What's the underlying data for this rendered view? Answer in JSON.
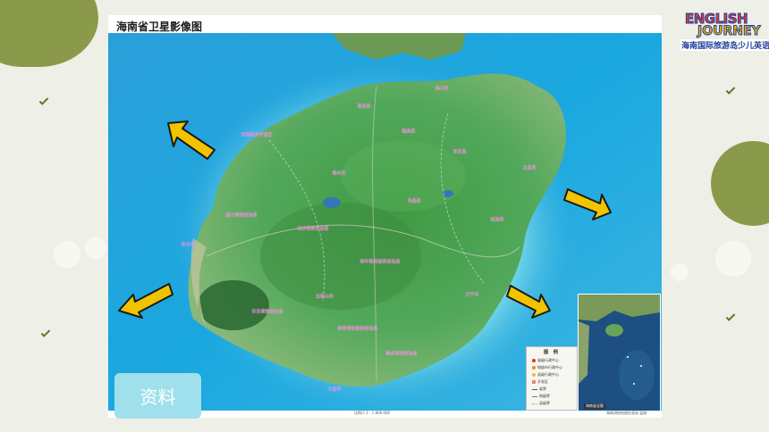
{
  "map": {
    "title": "海南省卫星影像图",
    "scale_text": "比例尺 1 : 1 800 000",
    "credit_text": "海南测绘地理信息局 监制",
    "inset_caption": "海南省全图",
    "places": [
      {
        "name": "洋浦经济开发区"
      },
      {
        "name": "海口市"
      },
      {
        "name": "文昌市"
      },
      {
        "name": "琼海市"
      },
      {
        "name": "万宁市"
      },
      {
        "name": "澄迈县"
      },
      {
        "name": "定安县"
      },
      {
        "name": "儋州市"
      },
      {
        "name": "屯昌县"
      },
      {
        "name": "昌江黎族自治县"
      },
      {
        "name": "琼中黎族苗族自治县"
      },
      {
        "name": "东方市"
      },
      {
        "name": "五指山市"
      },
      {
        "name": "白沙黎族自治县"
      },
      {
        "name": "乐东黎族自治县"
      },
      {
        "name": "保亭黎族苗族自治县"
      },
      {
        "name": "陵水黎族自治县"
      },
      {
        "name": "三亚市"
      },
      {
        "name": "临高县"
      }
    ],
    "legend": {
      "title": "图 例",
      "items": [
        {
          "label": "省级行政中心",
          "color": "#e0332b"
        },
        {
          "label": "地级市行政中心",
          "color": "#f28c1e"
        },
        {
          "label": "县级行政中心",
          "color": "#f5b82e"
        },
        {
          "label": "开发区",
          "color": "#f08080"
        },
        {
          "label": "省界",
          "color": "#555555"
        },
        {
          "label": "地级界",
          "color": "#777777"
        },
        {
          "label": "县级界",
          "color": "#999999"
        }
      ]
    }
  },
  "logo": {
    "line1": "ENGLISH",
    "line2": "JOURNEY",
    "subtitle": "海南国际旅游岛少儿英语"
  },
  "badge": {
    "label": "资料"
  },
  "arrow_color": "#f2c300"
}
